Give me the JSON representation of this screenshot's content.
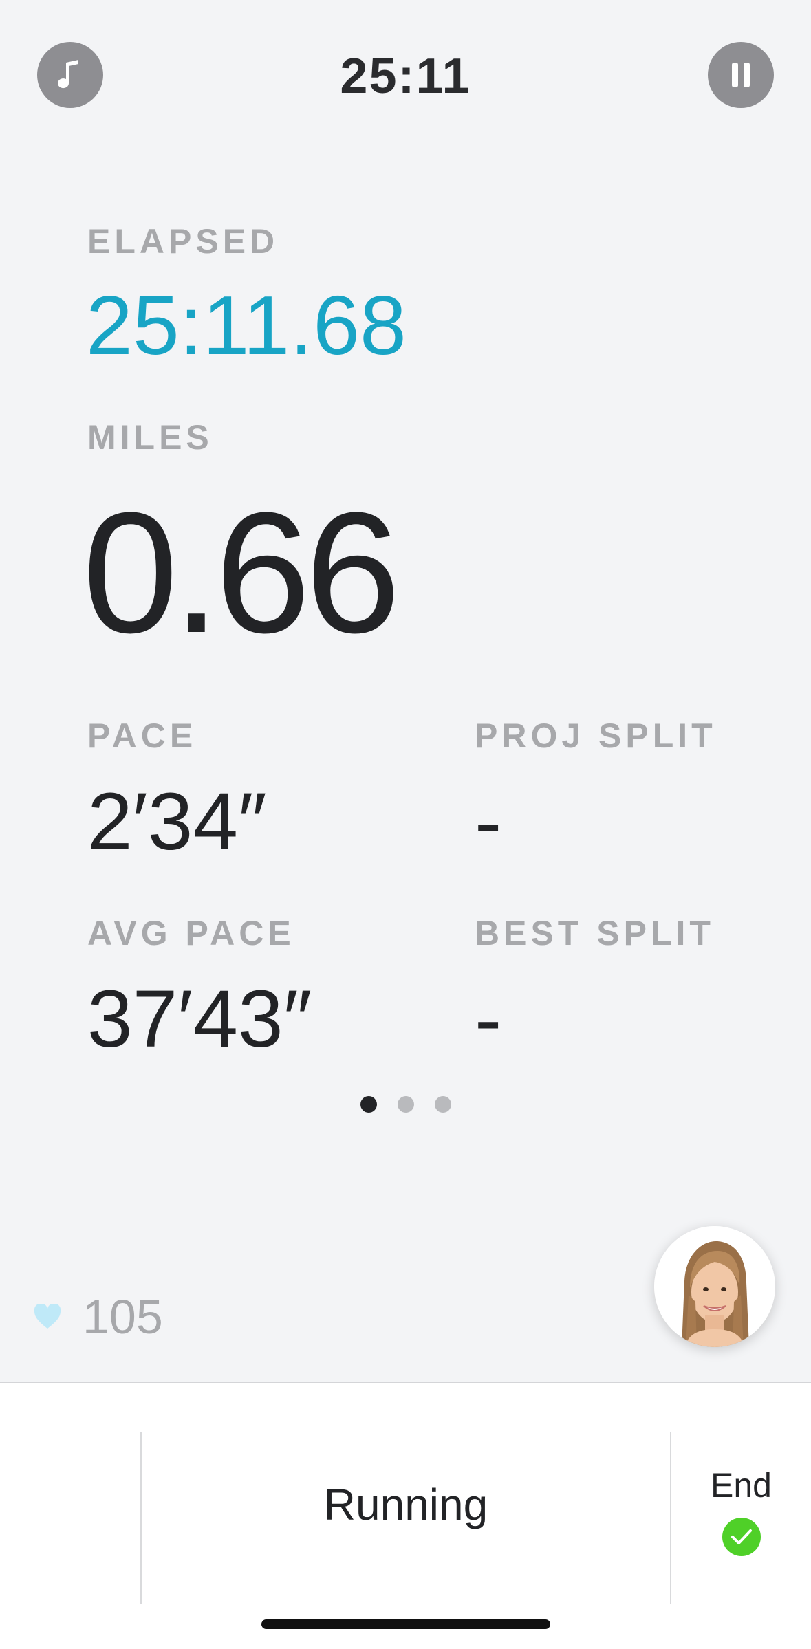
{
  "header": {
    "timer": "25:11",
    "music_icon": "music-note-icon",
    "pause_icon": "pause-icon"
  },
  "metrics": {
    "elapsed": {
      "label": "ELAPSED",
      "value": "25:11.68"
    },
    "miles": {
      "label": "MILES",
      "value": "0.66"
    },
    "pace": {
      "label": "PACE",
      "value": "2′34″"
    },
    "proj_split": {
      "label": "PROJ SPLIT",
      "value": "-"
    },
    "avg_pace": {
      "label": "AVG PACE",
      "value": "37′43″"
    },
    "best_split": {
      "label": "BEST SPLIT",
      "value": "-"
    }
  },
  "pager": {
    "total": 3,
    "active": 1
  },
  "heart_rate": {
    "value": "105",
    "icon": "heart-icon"
  },
  "instructor": {
    "icon": "instructor-avatar"
  },
  "bottom_bar": {
    "mode_label": "Running",
    "end_label": "End",
    "end_icon": "checkmark-icon"
  },
  "colors": {
    "background": "#f3f4f6",
    "accent": "#18a4c5",
    "label": "#a7a8ab",
    "text": "#222326",
    "icon_button": "#8e8e92",
    "heart": "#bfe9f8",
    "end_check": "#4fd028"
  }
}
